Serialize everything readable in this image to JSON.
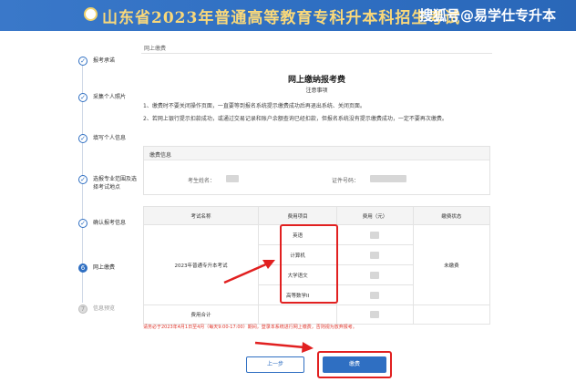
{
  "banner": {
    "title": "山东省2023年普通高等教育专科升本科招生考试",
    "watermark": "搜狐号@易学仕专升本"
  },
  "steps": [
    {
      "label": "报考承诺",
      "state": "done"
    },
    {
      "label": "采集个人照片",
      "state": "done"
    },
    {
      "label": "填写个人信息",
      "state": "done"
    },
    {
      "label": "选报专业范围及选择考试地点",
      "state": "done"
    },
    {
      "label": "确认报考信息",
      "state": "done"
    },
    {
      "label": "网上缴费",
      "state": "active",
      "num": "6"
    },
    {
      "label": "信息预览",
      "state": "pending",
      "num": "7"
    }
  ],
  "breadcrumb": "网上缴费",
  "page_title": "网上缴纳报考费",
  "notice_title": "注意事项",
  "notices": [
    "1、缴费时不要关闭操作页面，一直要等到报名系统提示缴费成功后再退出系统、关闭页面。",
    "2、若网上银行提示扣款成功，或通过交易记录和账户余额查询已经扣款，但报名系统没有提示缴费成功，一定不要再次缴费。"
  ],
  "info": {
    "header": "缴费信息",
    "name_label": "考生姓名：",
    "id_label": "证件号码："
  },
  "table": {
    "headers": [
      "考试名称",
      "费用项目",
      "费用（元）",
      "缴费状态"
    ],
    "exam_name": "2023年普通专升本考试",
    "items": [
      "英语",
      "计算机",
      "大学语文",
      "高等数学II"
    ],
    "status": "未缴费",
    "total_label": "费用合计"
  },
  "warning": "请务必于2023年4月1日至4月（每天9:00-17:00）期间，登录本系统进行网上缴费，否则视为放弃报考。",
  "buttons": {
    "prev": "上一步",
    "pay": "缴费"
  },
  "colors": {
    "primary": "#2f6fc2",
    "title_gold": "#f9d87a",
    "highlight_red": "#e12020"
  }
}
